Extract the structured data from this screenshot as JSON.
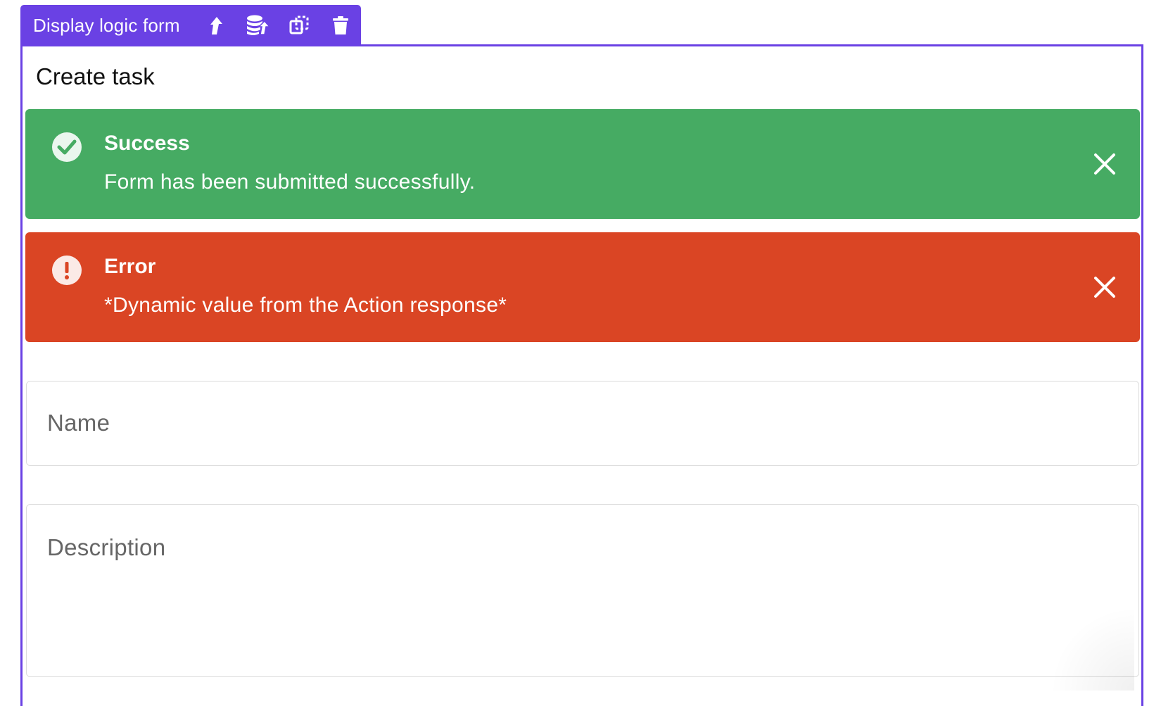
{
  "toolbar": {
    "title": "Display logic form",
    "buttons": [
      {
        "icon": "move-up-arrow-icon"
      },
      {
        "icon": "data-stack-icon"
      },
      {
        "icon": "duplicate-icon"
      },
      {
        "icon": "trash-icon"
      }
    ]
  },
  "form": {
    "title": "Create task"
  },
  "alerts": {
    "success": {
      "heading": "Success",
      "message": "Form has been submitted successfully.",
      "color": "#46ab63"
    },
    "error": {
      "heading": "Error",
      "message": "*Dynamic value from the Action response*",
      "color": "#da4524"
    }
  },
  "fields": {
    "name": {
      "label": "Name"
    },
    "description": {
      "label": "Description"
    }
  },
  "colors": {
    "accent": "#6a41e4"
  }
}
